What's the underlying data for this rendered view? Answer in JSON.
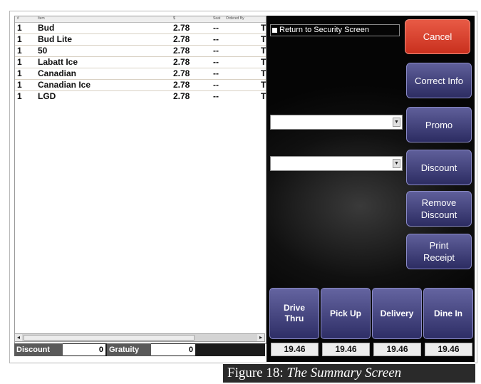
{
  "ticket": {
    "headers": {
      "qty": "#",
      "item": "Item",
      "price": "$",
      "seat": "Seat",
      "ordered_by": "Ordered By"
    },
    "rows": [
      {
        "qty": "1",
        "item": "Bud",
        "price": "2.78",
        "seat": "--",
        "ordered_by": "T"
      },
      {
        "qty": "1",
        "item": "Bud Lite",
        "price": "2.78",
        "seat": "--",
        "ordered_by": "T"
      },
      {
        "qty": "1",
        "item": "50",
        "price": "2.78",
        "seat": "--",
        "ordered_by": "T"
      },
      {
        "qty": "1",
        "item": "Labatt Ice",
        "price": "2.78",
        "seat": "--",
        "ordered_by": "T"
      },
      {
        "qty": "1",
        "item": "Canadian",
        "price": "2.78",
        "seat": "--",
        "ordered_by": "T"
      },
      {
        "qty": "1",
        "item": "Canadian Ice",
        "price": "2.78",
        "seat": "--",
        "ordered_by": "T"
      },
      {
        "qty": "1",
        "item": "LGD",
        "price": "2.78",
        "seat": "--",
        "ordered_by": "T"
      }
    ]
  },
  "totals": {
    "discount_label": "Discount",
    "discount_value": "0",
    "gratuity_label": "Gratuity",
    "gratuity_value": "0"
  },
  "controls": {
    "return_checkbox": "Return to Security Screen",
    "cancel": "Cancel",
    "correct_info": "Correct Info",
    "promo": "Promo",
    "discount": "Discount",
    "remove_discount": "Remove\nDiscount",
    "print_receipt": "Print\nReceipt"
  },
  "order_modes": [
    {
      "label": "Drive\nThru",
      "amount": "19.46"
    },
    {
      "label": "Pick Up",
      "amount": "19.46"
    },
    {
      "label": "Delivery",
      "amount": "19.46"
    },
    {
      "label": "Dine In",
      "amount": "19.46"
    }
  ],
  "caption": {
    "prefix": "Figure 18: ",
    "title": "The Summary Screen"
  },
  "colors": {
    "cancel": "#d8412d",
    "action_button": "#3f3f7a",
    "panel_bg": "#0c0c0c"
  }
}
